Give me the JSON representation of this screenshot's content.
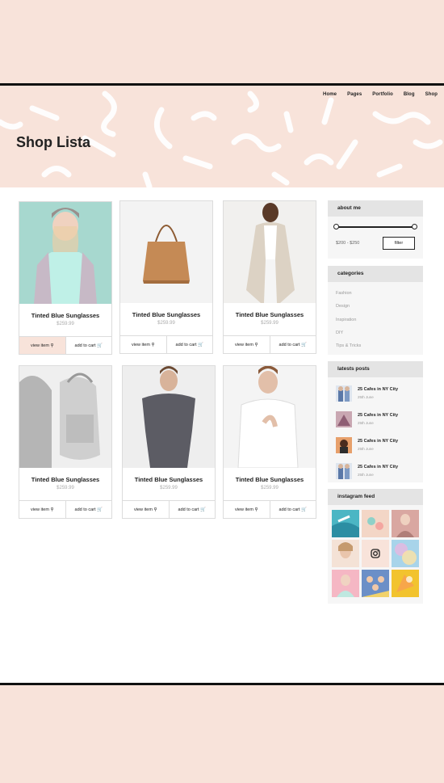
{
  "nav": {
    "items": [
      "Home",
      "Pages",
      "Portfolio",
      "Blog",
      "Shop"
    ]
  },
  "page": {
    "title": "Shop Lista"
  },
  "products": [
    {
      "name": "Tinted Blue Sunglasses",
      "price": "$259.99",
      "view": "view item",
      "cart": "add to cart"
    },
    {
      "name": "Tinted Blue Sunglasses",
      "price": "$259.99",
      "view": "view item",
      "cart": "add to cart"
    },
    {
      "name": "Tinted Blue Sunglasses",
      "price": "$259.99",
      "view": "view item",
      "cart": "add to cart"
    },
    {
      "name": "Tinted Blue Sunglasses",
      "price": "$259.99",
      "view": "view item",
      "cart": "add to cart"
    },
    {
      "name": "Tinted Blue Sunglasses",
      "price": "$259.99",
      "view": "view item",
      "cart": "add to cart"
    },
    {
      "name": "Tinted Blue Sunglasses",
      "price": "$259.99",
      "view": "view item",
      "cart": "add to cart"
    }
  ],
  "sidebar": {
    "about": {
      "heading": "about me",
      "range": "$200 - $250",
      "filter": "filter"
    },
    "categories": {
      "heading": "categories",
      "items": [
        "Fashion",
        "Design",
        "Inspiration",
        "DIY",
        "Tips & Tricks"
      ]
    },
    "posts": {
      "heading": "latests posts",
      "items": [
        {
          "title": "25 Cafes in NY City",
          "date": "25th June"
        },
        {
          "title": "25 Cafes in NY City",
          "date": "25th June"
        },
        {
          "title": "25 Cafes in NY City",
          "date": "25th June"
        },
        {
          "title": "25 Cafes in NY City",
          "date": "25th June"
        }
      ]
    },
    "instagram": {
      "heading": "instagram feed"
    }
  },
  "colors": {
    "peach": "#f8e3da",
    "dark": "#111111",
    "accent": "#bde3dc"
  }
}
